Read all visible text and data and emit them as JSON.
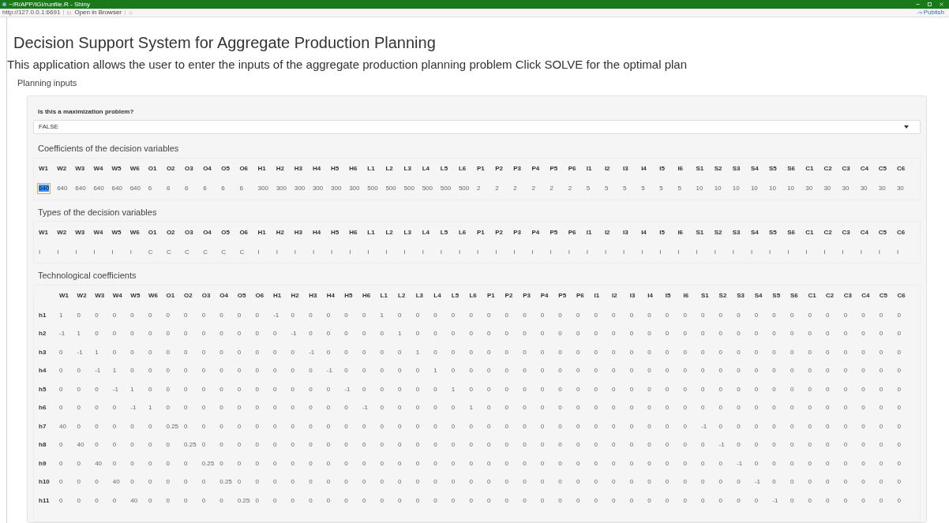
{
  "window": {
    "title": "~/R/APP/IGI/runfile.R - Shiny"
  },
  "toolbar": {
    "url": "http://127.0.0.1:6691",
    "open_in_browser": "Open in Browser",
    "publish": "Publish"
  },
  "page": {
    "title": "Decision Support System for Aggregate Production Planning",
    "description": "This application allows the user to enter the inputs of the aggregate production planning problem Click SOLVE for the optimal plan",
    "section": "Planning inputs"
  },
  "maximization": {
    "label": "Is this a maximization problem?",
    "value": "FALSE"
  },
  "coefficients": {
    "title": "Coefficients of the decision variables",
    "columns": [
      "W1",
      "W2",
      "W3",
      "W4",
      "W5",
      "W6",
      "O1",
      "O2",
      "O3",
      "O4",
      "O5",
      "O6",
      "H1",
      "H2",
      "H3",
      "H4",
      "H5",
      "H6",
      "L1",
      "L2",
      "L3",
      "L4",
      "L5",
      "L6",
      "P1",
      "P2",
      "P3",
      "P4",
      "P5",
      "P6",
      "I1",
      "I2",
      "I3",
      "I4",
      "I5",
      "I6",
      "S1",
      "S2",
      "S3",
      "S4",
      "S5",
      "S6",
      "C1",
      "C2",
      "C3",
      "C4",
      "C5",
      "C6"
    ],
    "values": [
      {
        "value": "640",
        "selected": true
      },
      {
        "value": "640",
        "selected": false
      },
      {
        "value": "640",
        "selected": false
      },
      {
        "value": "640",
        "selected": false
      },
      {
        "value": "640",
        "selected": false
      },
      {
        "value": "640",
        "selected": false
      },
      {
        "value": "6",
        "selected": false
      },
      {
        "value": "6",
        "selected": false
      },
      {
        "value": "6",
        "selected": false
      },
      {
        "value": "6",
        "selected": false
      },
      {
        "value": "6",
        "selected": false
      },
      {
        "value": "6",
        "selected": false
      },
      {
        "value": "300",
        "selected": false
      },
      {
        "value": "300",
        "selected": false
      },
      {
        "value": "300",
        "selected": false
      },
      {
        "value": "300",
        "selected": false
      },
      {
        "value": "300",
        "selected": false
      },
      {
        "value": "300",
        "selected": false
      },
      {
        "value": "500",
        "selected": false
      },
      {
        "value": "500",
        "selected": false
      },
      {
        "value": "500",
        "selected": false
      },
      {
        "value": "500",
        "selected": false
      },
      {
        "value": "500",
        "selected": false
      },
      {
        "value": "500",
        "selected": false
      },
      {
        "value": "2",
        "selected": false
      },
      {
        "value": "2",
        "selected": false
      },
      {
        "value": "2",
        "selected": false
      },
      {
        "value": "2",
        "selected": false
      },
      {
        "value": "2",
        "selected": false
      },
      {
        "value": "2",
        "selected": false
      },
      {
        "value": "5",
        "selected": false
      },
      {
        "value": "5",
        "selected": false
      },
      {
        "value": "5",
        "selected": false
      },
      {
        "value": "5",
        "selected": false
      },
      {
        "value": "5",
        "selected": false
      },
      {
        "value": "5",
        "selected": false
      },
      {
        "value": "10",
        "selected": false
      },
      {
        "value": "10",
        "selected": false
      },
      {
        "value": "10",
        "selected": false
      },
      {
        "value": "10",
        "selected": false
      },
      {
        "value": "10",
        "selected": false
      },
      {
        "value": "10",
        "selected": false
      },
      {
        "value": "30",
        "selected": false
      },
      {
        "value": "30",
        "selected": false
      },
      {
        "value": "30",
        "selected": false
      },
      {
        "value": "30",
        "selected": false
      },
      {
        "value": "30",
        "selected": false
      },
      {
        "value": "30",
        "selected": false
      }
    ]
  },
  "types": {
    "title": "Types of the decision variables",
    "columns": [
      "W1",
      "W2",
      "W3",
      "W4",
      "W5",
      "W6",
      "O1",
      "O2",
      "O3",
      "O4",
      "O5",
      "O6",
      "H1",
      "H2",
      "H3",
      "H4",
      "H5",
      "H6",
      "L1",
      "L2",
      "L3",
      "L4",
      "L5",
      "L6",
      "P1",
      "P2",
      "P3",
      "P4",
      "P5",
      "P6",
      "I1",
      "I2",
      "I3",
      "I4",
      "I5",
      "I6",
      "S1",
      "S2",
      "S3",
      "S4",
      "S5",
      "S6",
      "C1",
      "C2",
      "C3",
      "C4",
      "C5",
      "C6"
    ],
    "values": [
      "I",
      "I",
      "I",
      "I",
      "I",
      "I",
      "C",
      "C",
      "C",
      "C",
      "C",
      "C",
      "I",
      "I",
      "I",
      "I",
      "I",
      "I",
      "I",
      "I",
      "I",
      "I",
      "I",
      "I",
      "I",
      "I",
      "I",
      "I",
      "I",
      "I",
      "I",
      "I",
      "I",
      "I",
      "I",
      "I",
      "I",
      "I",
      "I",
      "I",
      "I",
      "I",
      "I",
      "I",
      "I",
      "I",
      "I",
      "I"
    ]
  },
  "technological": {
    "title": "Technological coefficients",
    "columns": [
      "W1",
      "W2",
      "W3",
      "W4",
      "W5",
      "W6",
      "O1",
      "O2",
      "O3",
      "O4",
      "O5",
      "O6",
      "H1",
      "H2",
      "H3",
      "H4",
      "H5",
      "H6",
      "L1",
      "L2",
      "L3",
      "L4",
      "L5",
      "L6",
      "P1",
      "P2",
      "P3",
      "P4",
      "P5",
      "P6",
      "I1",
      "I2",
      "I3",
      "I4",
      "I5",
      "I6",
      "S1",
      "S2",
      "S3",
      "S4",
      "S5",
      "S6",
      "C1",
      "C2",
      "C3",
      "C4",
      "C5",
      "C6"
    ],
    "rows": [
      {
        "label": "h1",
        "values": [
          "1",
          "0",
          "0",
          "0",
          "0",
          "0",
          "0",
          "0",
          "0",
          "0",
          "0",
          "0",
          "-1",
          "0",
          "0",
          "0",
          "0",
          "0",
          "1",
          "0",
          "0",
          "0",
          "0",
          "0",
          "0",
          "0",
          "0",
          "0",
          "0",
          "0",
          "0",
          "0",
          "0",
          "0",
          "0",
          "0",
          "0",
          "0",
          "0",
          "0",
          "0",
          "0",
          "0",
          "0",
          "0",
          "0",
          "0",
          "0"
        ]
      },
      {
        "label": "h2",
        "values": [
          "-1",
          "1",
          "0",
          "0",
          "0",
          "0",
          "0",
          "0",
          "0",
          "0",
          "0",
          "0",
          "0",
          "-1",
          "0",
          "0",
          "0",
          "0",
          "0",
          "1",
          "0",
          "0",
          "0",
          "0",
          "0",
          "0",
          "0",
          "0",
          "0",
          "0",
          "0",
          "0",
          "0",
          "0",
          "0",
          "0",
          "0",
          "0",
          "0",
          "0",
          "0",
          "0",
          "0",
          "0",
          "0",
          "0",
          "0",
          "0"
        ]
      },
      {
        "label": "h3",
        "values": [
          "0",
          "-1",
          "1",
          "0",
          "0",
          "0",
          "0",
          "0",
          "0",
          "0",
          "0",
          "0",
          "0",
          "0",
          "-1",
          "0",
          "0",
          "0",
          "0",
          "0",
          "1",
          "0",
          "0",
          "0",
          "0",
          "0",
          "0",
          "0",
          "0",
          "0",
          "0",
          "0",
          "0",
          "0",
          "0",
          "0",
          "0",
          "0",
          "0",
          "0",
          "0",
          "0",
          "0",
          "0",
          "0",
          "0",
          "0",
          "0"
        ]
      },
      {
        "label": "h4",
        "values": [
          "0",
          "0",
          "-1",
          "1",
          "0",
          "0",
          "0",
          "0",
          "0",
          "0",
          "0",
          "0",
          "0",
          "0",
          "0",
          "-1",
          "0",
          "0",
          "0",
          "0",
          "0",
          "1",
          "0",
          "0",
          "0",
          "0",
          "0",
          "0",
          "0",
          "0",
          "0",
          "0",
          "0",
          "0",
          "0",
          "0",
          "0",
          "0",
          "0",
          "0",
          "0",
          "0",
          "0",
          "0",
          "0",
          "0",
          "0",
          "0"
        ]
      },
      {
        "label": "h5",
        "values": [
          "0",
          "0",
          "0",
          "-1",
          "1",
          "0",
          "0",
          "0",
          "0",
          "0",
          "0",
          "0",
          "0",
          "0",
          "0",
          "0",
          "-1",
          "0",
          "0",
          "0",
          "0",
          "0",
          "1",
          "0",
          "0",
          "0",
          "0",
          "0",
          "0",
          "0",
          "0",
          "0",
          "0",
          "0",
          "0",
          "0",
          "0",
          "0",
          "0",
          "0",
          "0",
          "0",
          "0",
          "0",
          "0",
          "0",
          "0",
          "0"
        ]
      },
      {
        "label": "h6",
        "values": [
          "0",
          "0",
          "0",
          "0",
          "-1",
          "1",
          "0",
          "0",
          "0",
          "0",
          "0",
          "0",
          "0",
          "0",
          "0",
          "0",
          "0",
          "-1",
          "0",
          "0",
          "0",
          "0",
          "0",
          "1",
          "0",
          "0",
          "0",
          "0",
          "0",
          "0",
          "0",
          "0",
          "0",
          "0",
          "0",
          "0",
          "0",
          "0",
          "0",
          "0",
          "0",
          "0",
          "0",
          "0",
          "0",
          "0",
          "0",
          "0"
        ]
      },
      {
        "label": "h7",
        "values": [
          "40",
          "0",
          "0",
          "0",
          "0",
          "0",
          "0.25",
          "0",
          "0",
          "0",
          "0",
          "0",
          "0",
          "0",
          "0",
          "0",
          "0",
          "0",
          "0",
          "0",
          "0",
          "0",
          "0",
          "0",
          "0",
          "0",
          "0",
          "0",
          "0",
          "0",
          "0",
          "0",
          "0",
          "0",
          "0",
          "0",
          "-1",
          "0",
          "0",
          "0",
          "0",
          "0",
          "0",
          "0",
          "0",
          "0",
          "0",
          "0"
        ]
      },
      {
        "label": "h8",
        "values": [
          "0",
          "40",
          "0",
          "0",
          "0",
          "0",
          "0",
          "0.25",
          "0",
          "0",
          "0",
          "0",
          "0",
          "0",
          "0",
          "0",
          "0",
          "0",
          "0",
          "0",
          "0",
          "0",
          "0",
          "0",
          "0",
          "0",
          "0",
          "0",
          "0",
          "0",
          "0",
          "0",
          "0",
          "0",
          "0",
          "0",
          "0",
          "-1",
          "0",
          "0",
          "0",
          "0",
          "0",
          "0",
          "0",
          "0",
          "0",
          "0"
        ]
      },
      {
        "label": "h9",
        "values": [
          "0",
          "0",
          "40",
          "0",
          "0",
          "0",
          "0",
          "0",
          "0.25",
          "0",
          "0",
          "0",
          "0",
          "0",
          "0",
          "0",
          "0",
          "0",
          "0",
          "0",
          "0",
          "0",
          "0",
          "0",
          "0",
          "0",
          "0",
          "0",
          "0",
          "0",
          "0",
          "0",
          "0",
          "0",
          "0",
          "0",
          "0",
          "0",
          "-1",
          "0",
          "0",
          "0",
          "0",
          "0",
          "0",
          "0",
          "0",
          "0"
        ]
      },
      {
        "label": "h10",
        "values": [
          "0",
          "0",
          "0",
          "40",
          "0",
          "0",
          "0",
          "0",
          "0",
          "0.25",
          "0",
          "0",
          "0",
          "0",
          "0",
          "0",
          "0",
          "0",
          "0",
          "0",
          "0",
          "0",
          "0",
          "0",
          "0",
          "0",
          "0",
          "0",
          "0",
          "0",
          "0",
          "0",
          "0",
          "0",
          "0",
          "0",
          "0",
          "0",
          "0",
          "-1",
          "0",
          "0",
          "0",
          "0",
          "0",
          "0",
          "0",
          "0"
        ]
      },
      {
        "label": "h11",
        "values": [
          "0",
          "0",
          "0",
          "0",
          "40",
          "0",
          "0",
          "0",
          "0",
          "0",
          "0.25",
          "0",
          "0",
          "0",
          "0",
          "0",
          "0",
          "0",
          "0",
          "0",
          "0",
          "0",
          "0",
          "0",
          "0",
          "0",
          "0",
          "0",
          "0",
          "0",
          "0",
          "0",
          "0",
          "0",
          "0",
          "0",
          "0",
          "0",
          "0",
          "0",
          "-1",
          "0",
          "0",
          "0",
          "0",
          "0",
          "0",
          "0"
        ]
      }
    ]
  }
}
